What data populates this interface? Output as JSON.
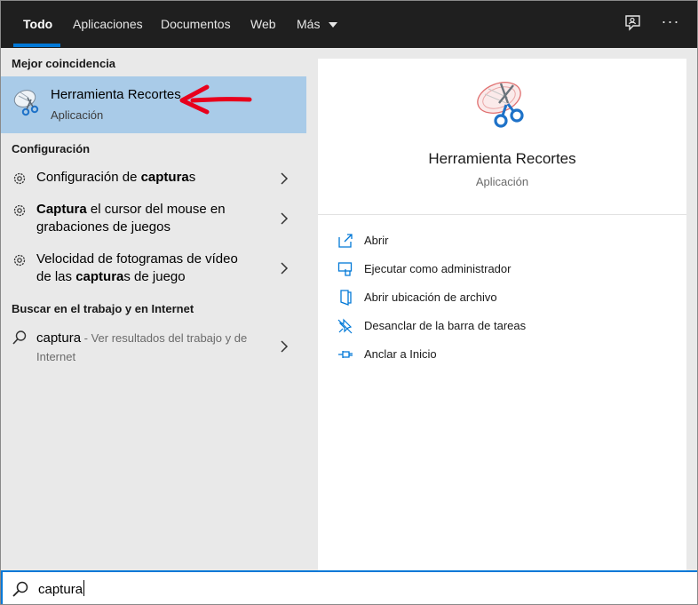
{
  "tabs": [
    {
      "label": "Todo",
      "active": true
    },
    {
      "label": "Aplicaciones"
    },
    {
      "label": "Documentos"
    },
    {
      "label": "Web"
    },
    {
      "label": "Más"
    }
  ],
  "top_icons": [
    "feedback-icon",
    "more-options-icon"
  ],
  "more_label": "···",
  "left": {
    "best_match_title": "Mejor coincidencia",
    "best_match": {
      "name": "Herramienta Recortes",
      "sub": "Aplicación",
      "icon": "snipping-tool-icon"
    },
    "settings_title": "Configuración",
    "settings": [
      {
        "pre": "Configuración de ",
        "bold": "captura",
        "post": "s",
        "line2": ""
      },
      {
        "pre": "",
        "bold": "Captura",
        "post": " el cursor del mouse en",
        "line2": "grabaciones de juegos"
      },
      {
        "pre": "Velocidad de fotogramas de vídeo",
        "bold": "",
        "post": "",
        "line2_pre": "de las ",
        "line2_bold": "captura",
        "line2_post": "s de juego"
      }
    ],
    "web_title": "Buscar en el trabajo y en Internet",
    "web_item": {
      "query": "captura",
      "hint": " - Ver resultados del trabajo y de",
      "hint2": "Internet"
    }
  },
  "right": {
    "app_name": "Herramienta Recortes",
    "app_sub": "Aplicación",
    "actions": [
      {
        "label": "Abrir",
        "icon": "open-icon"
      },
      {
        "label": "Ejecutar como administrador",
        "icon": "run-as-admin-icon"
      },
      {
        "label": "Abrir ubicación de archivo",
        "icon": "file-location-icon"
      },
      {
        "label": "Desanclar de la barra de tareas",
        "icon": "unpin-taskbar-icon"
      },
      {
        "label": "Anclar a Inicio",
        "icon": "pin-start-icon"
      }
    ]
  },
  "search": {
    "value": "captura"
  },
  "colors": {
    "accent": "#0078d7",
    "highlight": "#a9cbe8",
    "nav_bg": "#1f1f1f",
    "annotation": "#e8001c"
  }
}
